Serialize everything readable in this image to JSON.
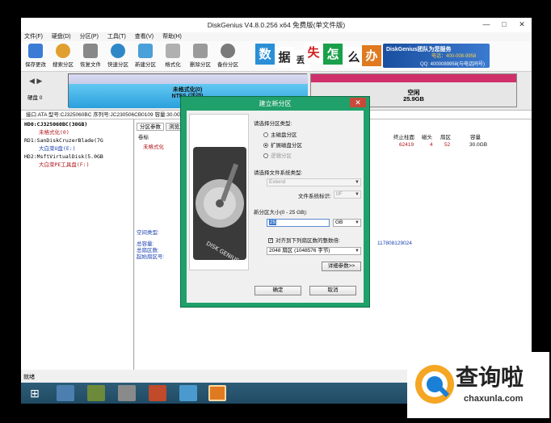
{
  "window": {
    "title": "DiskGenius V4.8.0.256 x64 免费版(单文件版)"
  },
  "menu": [
    "文件(F)",
    "硬盘(D)",
    "分区(P)",
    "工具(T)",
    "查看(V)",
    "帮助(H)"
  ],
  "toolbar": [
    "保存更改",
    "搜索分区",
    "恢复文件",
    "快速分区",
    "新建分区",
    "格式化",
    "删除分区",
    "备份分区"
  ],
  "banner": {
    "chars": [
      "数",
      "据",
      "丢",
      "失",
      "怎",
      "么",
      "办"
    ],
    "brand": "DiskGenius团队为您服务",
    "phone": "电话：400-008-9958",
    "qq": "QQ: 4000089958(与电话同号)"
  },
  "diskmap": {
    "disk_label": "硬盘 0",
    "p1_name": "未格式化(0)",
    "p1_fs": "NTFS (活动)",
    "p1_size": "3",
    "free_name": "空闲",
    "free_size": "25.9GB"
  },
  "infobar": "接口:ATA  型号:CJ325060BC  序列号:JC230506CB0109  容量:30.0GB(30720MB)  柱面数:3916  磁头数:255  每道扇区数:63  总扇区数:117231408",
  "tree": [
    "HD0:CJ325060BC(30GB)",
    "未格式化(0)",
    "RD1:SanDiskCruzerBlade(7G",
    "大白菜U盘(E:)",
    "HD2:MsftVirtualDisk(5.0GB",
    "大白菜PE工具盘(F:)"
  ],
  "tabs": [
    "分区参数",
    "浏览文件"
  ],
  "table": {
    "headers": [
      "卷标",
      "终止柱面",
      "磁头",
      "扇区",
      "容量"
    ],
    "row": [
      "未格式化",
      "62419",
      "4",
      "52",
      "30.0GB"
    ]
  },
  "detail": {
    "space_type": "空间类型:",
    "total": "总容量:",
    "total_sectors": "总扇区数:",
    "start_sector": "起始扇区号:",
    "sector_count": "117808129024"
  },
  "status": "就绪",
  "dialog": {
    "title": "建立新分区",
    "partition_type_label": "请选择分区类型:",
    "options": [
      "主磁盘分区",
      "扩展磁盘分区",
      "逻辑分区"
    ],
    "fs_label": "请选择文件系统类型:",
    "fs_value": "Extend",
    "fs_id_label": "文件系统标识:",
    "fs_id_value": "0F",
    "size_label": "新分区大小(0 - 25 GB):",
    "size_value": "25",
    "size_unit": "GB",
    "align_label": "对齐到下列扇区数的整数倍:",
    "align_value": "2048 扇区 (1048576 字节)",
    "advanced": "详细参数>>",
    "ok": "确定",
    "cancel": "取消"
  },
  "watermark": {
    "logo": "查询啦",
    "url": "chaxunla.com"
  },
  "colors": {
    "dialog_border": "#20a06a",
    "partition_blue": "#2aa0dd",
    "free_border": "#d0306a",
    "taskbar": "#2e5d78"
  }
}
